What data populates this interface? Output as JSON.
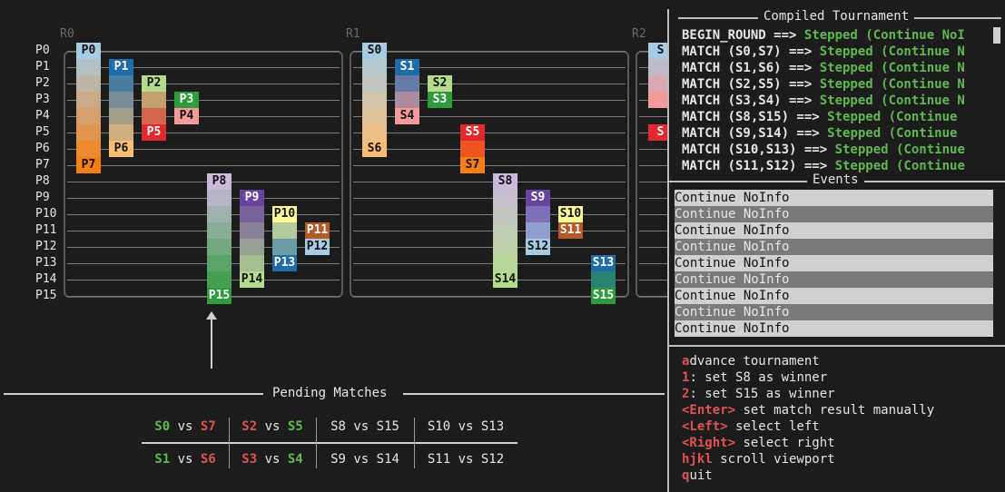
{
  "rounds": [
    "R0",
    "R1",
    "R2"
  ],
  "row_labels": [
    "P0",
    "P1",
    "P2",
    "P3",
    "P4",
    "P5",
    "P6",
    "P7",
    "P8",
    "P9",
    "P10",
    "P11",
    "P12",
    "P13",
    "P14",
    "P15"
  ],
  "r0_tags": [
    "P0",
    "P1",
    "P2",
    "P3",
    "P4",
    "P5",
    "P6",
    "P7",
    "P8",
    "P9",
    "P10",
    "P11",
    "P12",
    "P13",
    "P14",
    "P15"
  ],
  "r1_tags": [
    "S0",
    "S1",
    "S2",
    "S3",
    "S4",
    "S5",
    "S6",
    "S7",
    "S8",
    "S9",
    "S10",
    "S11",
    "S12",
    "S13",
    "S14",
    "S15"
  ],
  "r2_tags": [
    "S",
    "S"
  ],
  "pending": {
    "title": "Pending Matches",
    "vs": "vs",
    "row1": [
      {
        "a": "S0",
        "b": "S7",
        "a_state": "win",
        "b_state": "lose"
      },
      {
        "a": "S2",
        "b": "S5",
        "a_state": "lose",
        "b_state": "win"
      },
      {
        "a": "S8",
        "b": "S15",
        "a_state": "none",
        "b_state": "none"
      },
      {
        "a": "S10",
        "b": "S13",
        "a_state": "none",
        "b_state": "none"
      }
    ],
    "row2": [
      {
        "a": "S1",
        "b": "S6",
        "a_state": "win",
        "b_state": "lose"
      },
      {
        "a": "S3",
        "b": "S4",
        "a_state": "lose",
        "b_state": "win"
      },
      {
        "a": "S9",
        "b": "S14",
        "a_state": "none",
        "b_state": "none"
      },
      {
        "a": "S11",
        "b": "S12",
        "a_state": "none",
        "b_state": "none"
      }
    ]
  },
  "compiled": {
    "title": "Compiled Tournament",
    "lines": [
      {
        "left": "BEGIN_ROUND ==> ",
        "right": "Stepped (Continue NoI"
      },
      {
        "left": "MATCH (S0,S7) ==> ",
        "right": "Stepped (Continue N"
      },
      {
        "left": "MATCH (S1,S6) ==> ",
        "right": "Stepped (Continue N"
      },
      {
        "left": "MATCH (S2,S5) ==> ",
        "right": "Stepped (Continue N"
      },
      {
        "left": "MATCH (S3,S4) ==> ",
        "right": "Stepped (Continue N"
      },
      {
        "left": "MATCH (S8,S15) ==> ",
        "right": "Stepped (Continue"
      },
      {
        "left": "MATCH (S9,S14) ==> ",
        "right": "Stepped (Continue"
      },
      {
        "left": "MATCH (S10,S13) ==> ",
        "right": "Stepped (Continue"
      },
      {
        "left": "MATCH (S11,S12) ==> ",
        "right": "Stepped (Continue"
      }
    ]
  },
  "events": {
    "title": "Events",
    "rows": [
      "Continue NoInfo",
      "Continue NoInfo",
      "Continue NoInfo",
      "Continue NoInfo",
      "Continue NoInfo",
      "Continue NoInfo",
      "Continue NoInfo",
      "Continue NoInfo",
      "Continue NoInfo"
    ]
  },
  "help": [
    {
      "key": "a",
      "rest": "dvance tournament"
    },
    {
      "key": "1",
      "rest": ": set S8 as winner"
    },
    {
      "key": "2",
      "rest": ": set S15 as winner"
    },
    {
      "key": "<Enter>",
      "rest": " set match result manually"
    },
    {
      "key": "<Left>",
      "rest": " select left"
    },
    {
      "key": "<Right>",
      "rest": " select right"
    },
    {
      "key": "hjkl",
      "rest": " scroll viewport"
    },
    {
      "key": "q",
      "rest": "uit"
    }
  ],
  "colors": {
    "accent_green": "#5fb84f",
    "accent_red": "#e05252",
    "border": "#5a5a5a"
  }
}
